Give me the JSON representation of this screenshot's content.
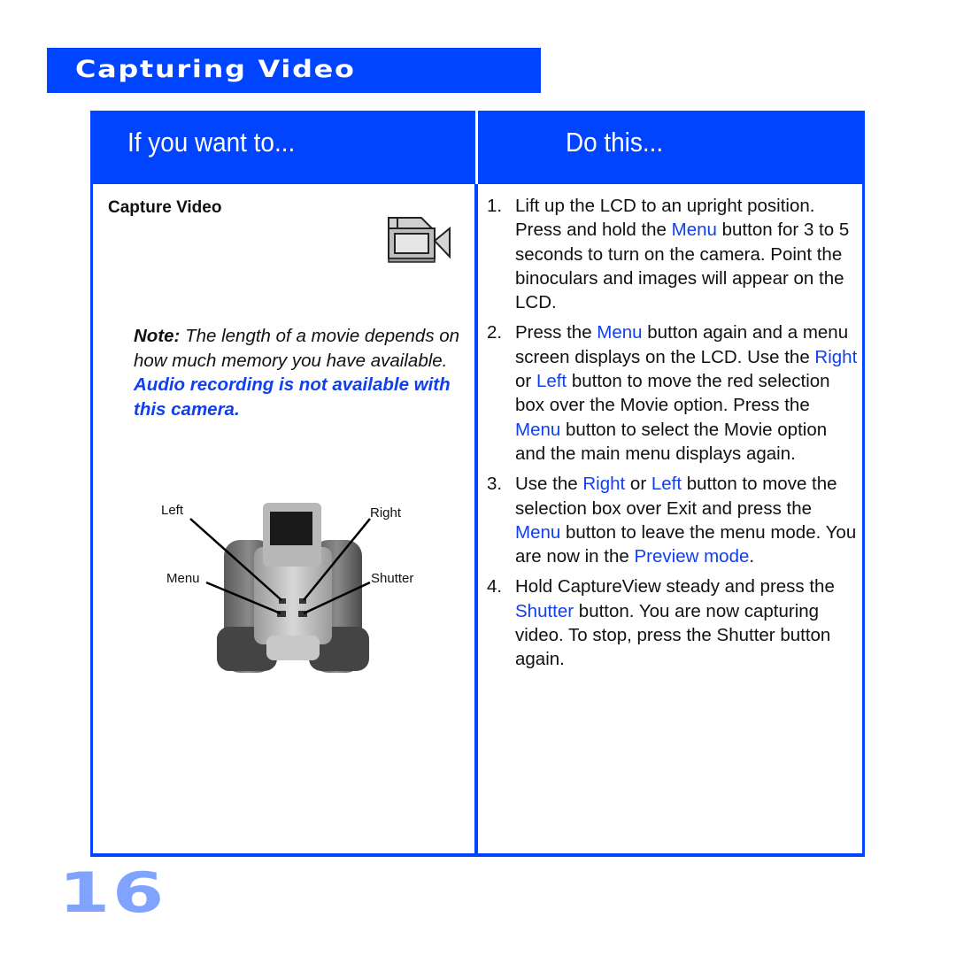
{
  "section": {
    "title": "Capturing Video"
  },
  "table": {
    "header_left": "If you want to...",
    "header_right": "Do this...",
    "task": {
      "title": "Capture Video",
      "icon": "video-camera-icon",
      "note_label": "Note:",
      "note_text": " The length of a movie depends on how much memory you have available. ",
      "note_warning": "Audio recording is not available with this camera."
    },
    "diagram": {
      "labels": {
        "left": "Left",
        "right": "Right",
        "menu": "Menu",
        "shutter": "Shutter"
      }
    },
    "steps": [
      {
        "number": "1.",
        "parts": [
          {
            "t": "Lift up the LCD to an upright position. Press and hold the "
          },
          {
            "t": "Menu",
            "hl": true
          },
          {
            "t": " button for 3 to 5 seconds to turn on the camera. Point the binoculars and images will appear on the LCD."
          }
        ]
      },
      {
        "number": "2.",
        "parts": [
          {
            "t": "Press the "
          },
          {
            "t": "Menu",
            "hl": true
          },
          {
            "t": " button again and a menu screen displays on the LCD. Use the "
          },
          {
            "t": "Right",
            "hl": true
          },
          {
            "t": " or "
          },
          {
            "t": "Left",
            "hl": true
          },
          {
            "t": " button to move the red selection box over the  Movie option. Press the "
          },
          {
            "t": "Menu",
            "hl": true
          },
          {
            "t": " button to select the Movie option and the main menu displays again."
          }
        ]
      },
      {
        "number": "3.",
        "parts": [
          {
            "t": "Use the "
          },
          {
            "t": "Right",
            "hl": true
          },
          {
            "t": " or "
          },
          {
            "t": "Left",
            "hl": true
          },
          {
            "t": " button to move the selection box over Exit and press the "
          },
          {
            "t": "Menu",
            "hl": true
          },
          {
            "t": " button to leave the menu mode. You are now in the "
          },
          {
            "t": "Preview mode",
            "hl": true
          },
          {
            "t": "."
          }
        ]
      },
      {
        "number": "4.",
        "parts": [
          {
            "t": "Hold CaptureView steady and press the "
          },
          {
            "t": "Shutter",
            "hl": true
          },
          {
            "t": " button. You are now capturing video. To stop, press the Shutter button again."
          }
        ]
      }
    ]
  },
  "page_number": "16",
  "colors": {
    "brand_blue": "#0044ff",
    "highlight_blue": "#1040ee",
    "page_number": "#7fa3ff"
  }
}
